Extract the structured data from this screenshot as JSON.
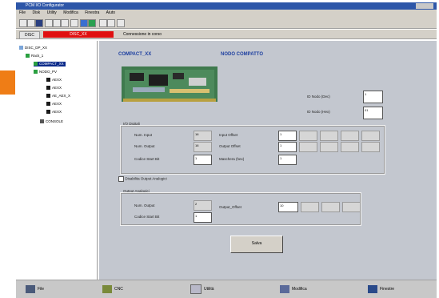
{
  "window": {
    "title": "PCM I/O Configurator"
  },
  "menu": [
    "File",
    "Disk",
    "Utility",
    "Modifica",
    "Finestra",
    "Aiuto"
  ],
  "status_strip": {
    "left": "DISC",
    "middle": "DISC_XX",
    "right": "Connessione in corso"
  },
  "tree": {
    "root": "DISC_DP_XX",
    "rack": "Rack_1",
    "items": [
      "COMPACT_XX",
      "NODO_PV",
      "AEXX",
      "AEXX",
      "AE_AEX_X",
      "AEXX",
      "AEXX",
      "CONSOLE"
    ]
  },
  "panel": {
    "heading_left": "COMPACT_XX",
    "heading_right": "NODO COMPATTO",
    "id_nodo_dec_label": "ID Nodo (Dec)",
    "id_nodo_dec": "1",
    "id_nodo_hex_label": "ID Nodo (Hex)",
    "id_nodo_hex": "01",
    "io_digitali": {
      "title": "I/O Digitali",
      "num_input_label": "Num. Input",
      "num_input": "16",
      "num_output_label": "Num. Output",
      "num_output": "16",
      "cod_start_bit_label": "Codice Start Bit",
      "cod_start_bit": "1",
      "input_offset_label": "Input Offset",
      "input_offset": "1",
      "output_offset_label": "Output Offset",
      "output_offset": "1",
      "maschera_label": "Maschera (hex)",
      "maschera": "1"
    },
    "output_analogici": {
      "checkbox_label": "Disabilita Output Analogici",
      "title": "Output Analogici",
      "num_output_label": "Num. Output",
      "num_output": "2",
      "cod_start_bit_label": "Codice Start Bit",
      "cod_start_bit": "1",
      "output_offset_label": "Output_Offset",
      "output_offset": "10"
    },
    "save_button": "Salva"
  },
  "taskbar": [
    "File",
    "CNC",
    "Utilità",
    "Modifica",
    "Finestre"
  ],
  "colors": {
    "accent_orange": "#ef7d16",
    "title_blue": "#2d56a8",
    "status_red": "#e01010",
    "heading_blue": "#1d3fa0"
  }
}
